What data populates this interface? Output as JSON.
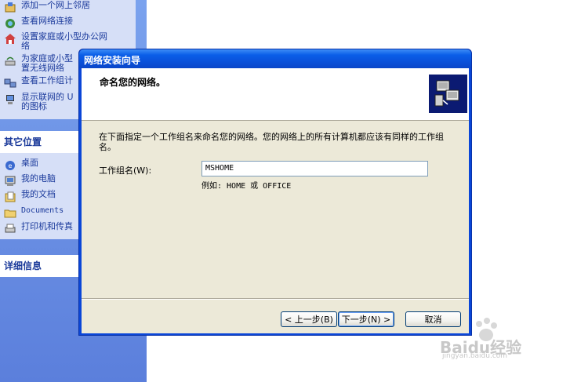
{
  "sidebar": {
    "network_tasks": [
      {
        "label": "添加一个网上邻居",
        "icon": "add-network-place-icon"
      },
      {
        "label": "查看网络连接",
        "icon": "network-connections-icon"
      },
      {
        "label": "设置家庭或小型办公网\n络",
        "icon": "home-network-setup-icon"
      },
      {
        "label": "为家庭或小型\n置无线网络",
        "icon": "wireless-network-icon"
      },
      {
        "label": "查看工作组计",
        "icon": "workgroup-computers-icon"
      },
      {
        "label": "显示联网的 U\n的图标",
        "icon": "upnp-devices-icon"
      }
    ],
    "other_places": {
      "header": "其它位置",
      "items": [
        {
          "label": "桌面",
          "icon": "desktop-icon"
        },
        {
          "label": "我的电脑",
          "icon": "my-computer-icon"
        },
        {
          "label": "我的文档",
          "icon": "my-documents-icon"
        },
        {
          "label": "Documents",
          "icon": "folder-icon"
        },
        {
          "label": "打印机和传真",
          "icon": "printers-faxes-icon"
        }
      ]
    },
    "details": {
      "header": "详细信息"
    }
  },
  "dialog": {
    "title": "网络安装向导",
    "heading": "命名您的网络。",
    "description": "在下面指定一个工作组名来命名您的网络。您的网络上的所有计算机都应该有同样的工作组名。",
    "workgroup_label": "工作组名(W):",
    "workgroup_value": "MSHOME",
    "example": "例如: HOME 或 OFFICE",
    "buttons": {
      "back": "< 上一步(B)",
      "next": "下一步(N) >",
      "cancel": "取消"
    }
  },
  "watermark": {
    "brand": "Baidu经验",
    "url": "jingyan.baidu.com"
  },
  "colors": {
    "title_bar": "#0a4fd8",
    "panel_bg": "#6a8fe3",
    "panel_box": "#d6dff7",
    "dialog_face": "#ece9d8",
    "link_text": "#1c3b9c"
  }
}
